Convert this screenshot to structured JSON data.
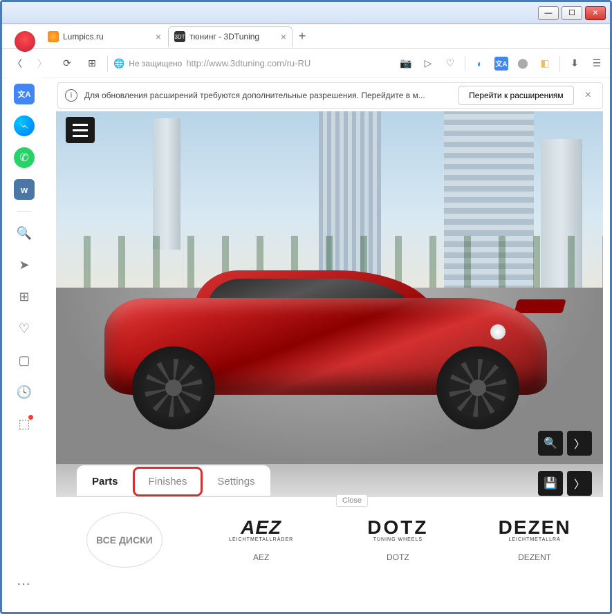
{
  "tabs": [
    {
      "title": "Lumpics.ru",
      "active": false
    },
    {
      "title": "тюнинг - 3DTuning",
      "active": true
    }
  ],
  "address": {
    "secure_label": "Не защищено",
    "url": "http://www.3dtuning.com/ru-RU"
  },
  "notification": {
    "text": "Для обновления расширений требуются дополнительные разрешения. Перейдите в м...",
    "button": "Перейти к расширениям"
  },
  "car_badge": "3DT",
  "content_tabs": {
    "items": [
      {
        "label": "Parts",
        "active": true,
        "highlight": false
      },
      {
        "label": "Finishes",
        "active": false,
        "highlight": true
      },
      {
        "label": "Settings",
        "active": false,
        "highlight": false
      }
    ],
    "close_label": "Close"
  },
  "brands": {
    "all_label": "ВСЕ ДИСКИ",
    "items": [
      {
        "logo": "AEZ",
        "sub": "LEICHTMETALLRÄDER",
        "name": "AEZ"
      },
      {
        "logo": "DOTZ",
        "sub": "TUNING WHEELS",
        "name": "DOTZ"
      },
      {
        "logo": "DEZEN",
        "sub": "LEICHTMETALLRÄ",
        "name": "DEZENT"
      }
    ]
  },
  "sidebar_icons": [
    "translate",
    "messenger",
    "whatsapp",
    "vk",
    "plus",
    "search",
    "send",
    "grid",
    "heart",
    "bookmark",
    "clock",
    "cube"
  ]
}
